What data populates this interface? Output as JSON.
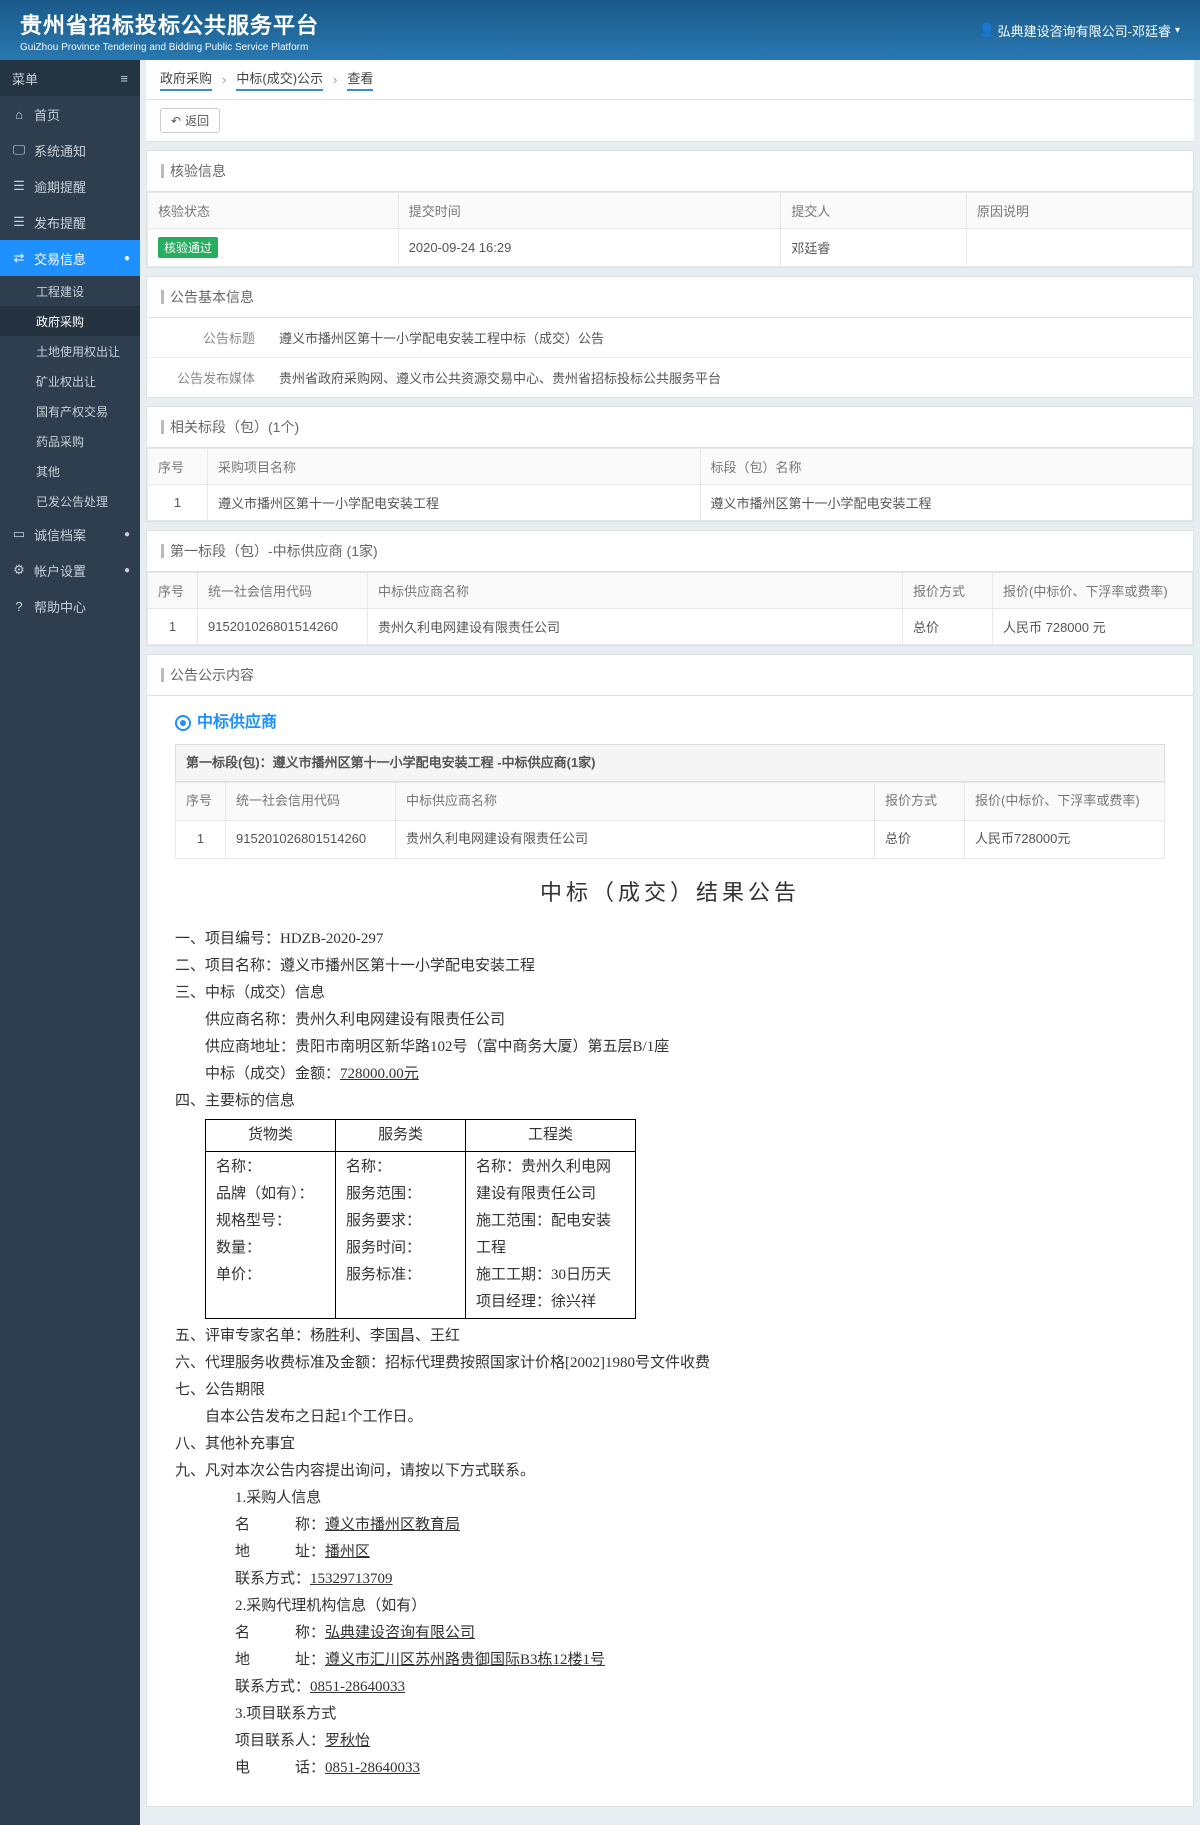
{
  "header": {
    "title": "贵州省招标投标公共服务平台",
    "subtitle": "GuiZhou Province Tendering and Bidding Public Service Platform",
    "user": "弘典建设咨询有限公司-邓廷睿"
  },
  "sidebar": {
    "menu_label": "菜单",
    "items": [
      {
        "label": "首页"
      },
      {
        "label": "系统通知"
      },
      {
        "label": "逾期提醒"
      },
      {
        "label": "发布提醒"
      },
      {
        "label": "交易信息",
        "active": true,
        "children": [
          {
            "label": "工程建设"
          },
          {
            "label": "政府采购",
            "selected": true
          },
          {
            "label": "土地使用权出让"
          },
          {
            "label": "矿业权出让"
          },
          {
            "label": "国有产权交易"
          },
          {
            "label": "药品采购"
          },
          {
            "label": "其他"
          },
          {
            "label": "已发公告处理"
          }
        ]
      },
      {
        "label": "诚信档案",
        "badge": "●"
      },
      {
        "label": "帐户设置",
        "badge": "●"
      },
      {
        "label": "帮助中心"
      }
    ]
  },
  "breadcrumb": [
    "政府采购",
    "中标(成交)公示",
    "查看"
  ],
  "back_label": "返回",
  "panels": {
    "verify": {
      "title": "核验信息",
      "cols": [
        "核验状态",
        "提交时间",
        "提交人",
        "原因说明"
      ],
      "row": {
        "status": "核验通过",
        "time": "2020-09-24 16:29",
        "submitter": "邓廷睿",
        "reason": ""
      }
    },
    "basic": {
      "title": "公告基本信息",
      "rows": [
        {
          "k": "公告标题",
          "v": "遵义市播州区第十一小学配电安装工程中标（成交）公告"
        },
        {
          "k": "公告发布媒体",
          "v": "贵州省政府采购网、遵义市公共资源交易中心、贵州省招标投标公共服务平台"
        }
      ]
    },
    "sections": {
      "title": "相关标段（包）(1个)",
      "cols": [
        "序号",
        "采购项目名称",
        "标段（包）名称"
      ],
      "row": {
        "no": "1",
        "proj": "遵义市播州区第十一小学配电安装工程",
        "section": "遵义市播州区第十一小学配电安装工程"
      }
    },
    "supplier1": {
      "title": "第一标段（包）-中标供应商 (1家)",
      "cols": [
        "序号",
        "统一社会信用代码",
        "中标供应商名称",
        "报价方式",
        "报价(中标价、下浮率或费率)"
      ],
      "row": {
        "no": "1",
        "code": "915201026801514260",
        "name": "贵州久利电网建设有限责任公司",
        "price_method": "总价",
        "price": "人民币 728000 元"
      }
    },
    "content_title": "公告公示内容"
  },
  "ann": {
    "supplier_label": "中标供应商",
    "sub_header": "第一标段(包)：遵义市播州区第十一小学配电安装工程 -中标供应商(1家)",
    "cols": [
      "序号",
      "统一社会信用代码",
      "中标供应商名称",
      "报价方式",
      "报价(中标价、下浮率或费率)"
    ],
    "row": {
      "no": "1",
      "code": "915201026801514260",
      "name": "贵州久利电网建设有限责任公司",
      "price_method": "总价",
      "price": "人民币728000元"
    },
    "title": "中标（成交）结果公告",
    "proj_no_label": "一、项目编号：",
    "proj_no": "HDZB-2020-297",
    "proj_name_label": "二、项目名称：",
    "proj_name": "遵义市播州区第十一小学配电安装工程",
    "win_info_label": "三、中标（成交）信息",
    "supplier_name_label": "供应商名称：",
    "supplier_name": "贵州久利电网建设有限责任公司",
    "supplier_addr_label": "供应商地址：",
    "supplier_addr": "贵阳市南明区新华路102号（富中商务大厦）第五层B/1座",
    "win_amount_label": "中标（成交）金额：",
    "win_amount": "728000.00元",
    "main_bid_label": "四、主要标的信息",
    "bid_table": {
      "headers": [
        "货物类",
        "服务类",
        "工程类"
      ],
      "col1": [
        "名称：",
        "品牌（如有）：",
        "规格型号：",
        "数量：",
        "单价："
      ],
      "col2": [
        "名称：",
        "服务范围：",
        "服务要求：",
        "服务时间：",
        "服务标准："
      ],
      "col3": [
        "名称：贵州久利电网建设有限责任公司",
        "施工范围：配电安装工程",
        "施工工期：30日历天",
        "项目经理：徐兴祥"
      ]
    },
    "experts_label": "五、评审专家名单：",
    "experts": "杨胜利、李国昌、王红",
    "agency_fee_label": "六、代理服务收费标准及金额：",
    "agency_fee": "招标代理费按照国家计价格[2002]1980号文件收费",
    "period_label": "七、公告期限",
    "period": "自本公告发布之日起1个工作日。",
    "other_label": "八、其他补充事宜",
    "contact_label": "九、凡对本次公告内容提出询问，请按以下方式联系。",
    "buyer_info_label": "1.采购人信息",
    "buyer_name_k": "名　　　称：",
    "buyer_name": "遵义市播州区教育局",
    "buyer_addr_k": "地　　　址：",
    "buyer_addr": "播州区",
    "buyer_tel_k": "联系方式：",
    "buyer_tel": "15329713709",
    "agency_info_label": "2.采购代理机构信息（如有）",
    "agency_name_k": "名　　　称：",
    "agency_name": "弘典建设咨询有限公司",
    "agency_addr_k": "地　　　址：",
    "agency_addr": "遵义市汇川区苏州路贵御国际B3栋12楼1号",
    "agency_tel_k": "联系方式：",
    "agency_tel": "0851-28640033",
    "proj_contact_label": "3.项目联系方式",
    "proj_contact_k": "项目联系人：",
    "proj_contact": "罗秋怡",
    "proj_tel_k": "电　　　话：",
    "proj_tel": "0851-28640033"
  }
}
